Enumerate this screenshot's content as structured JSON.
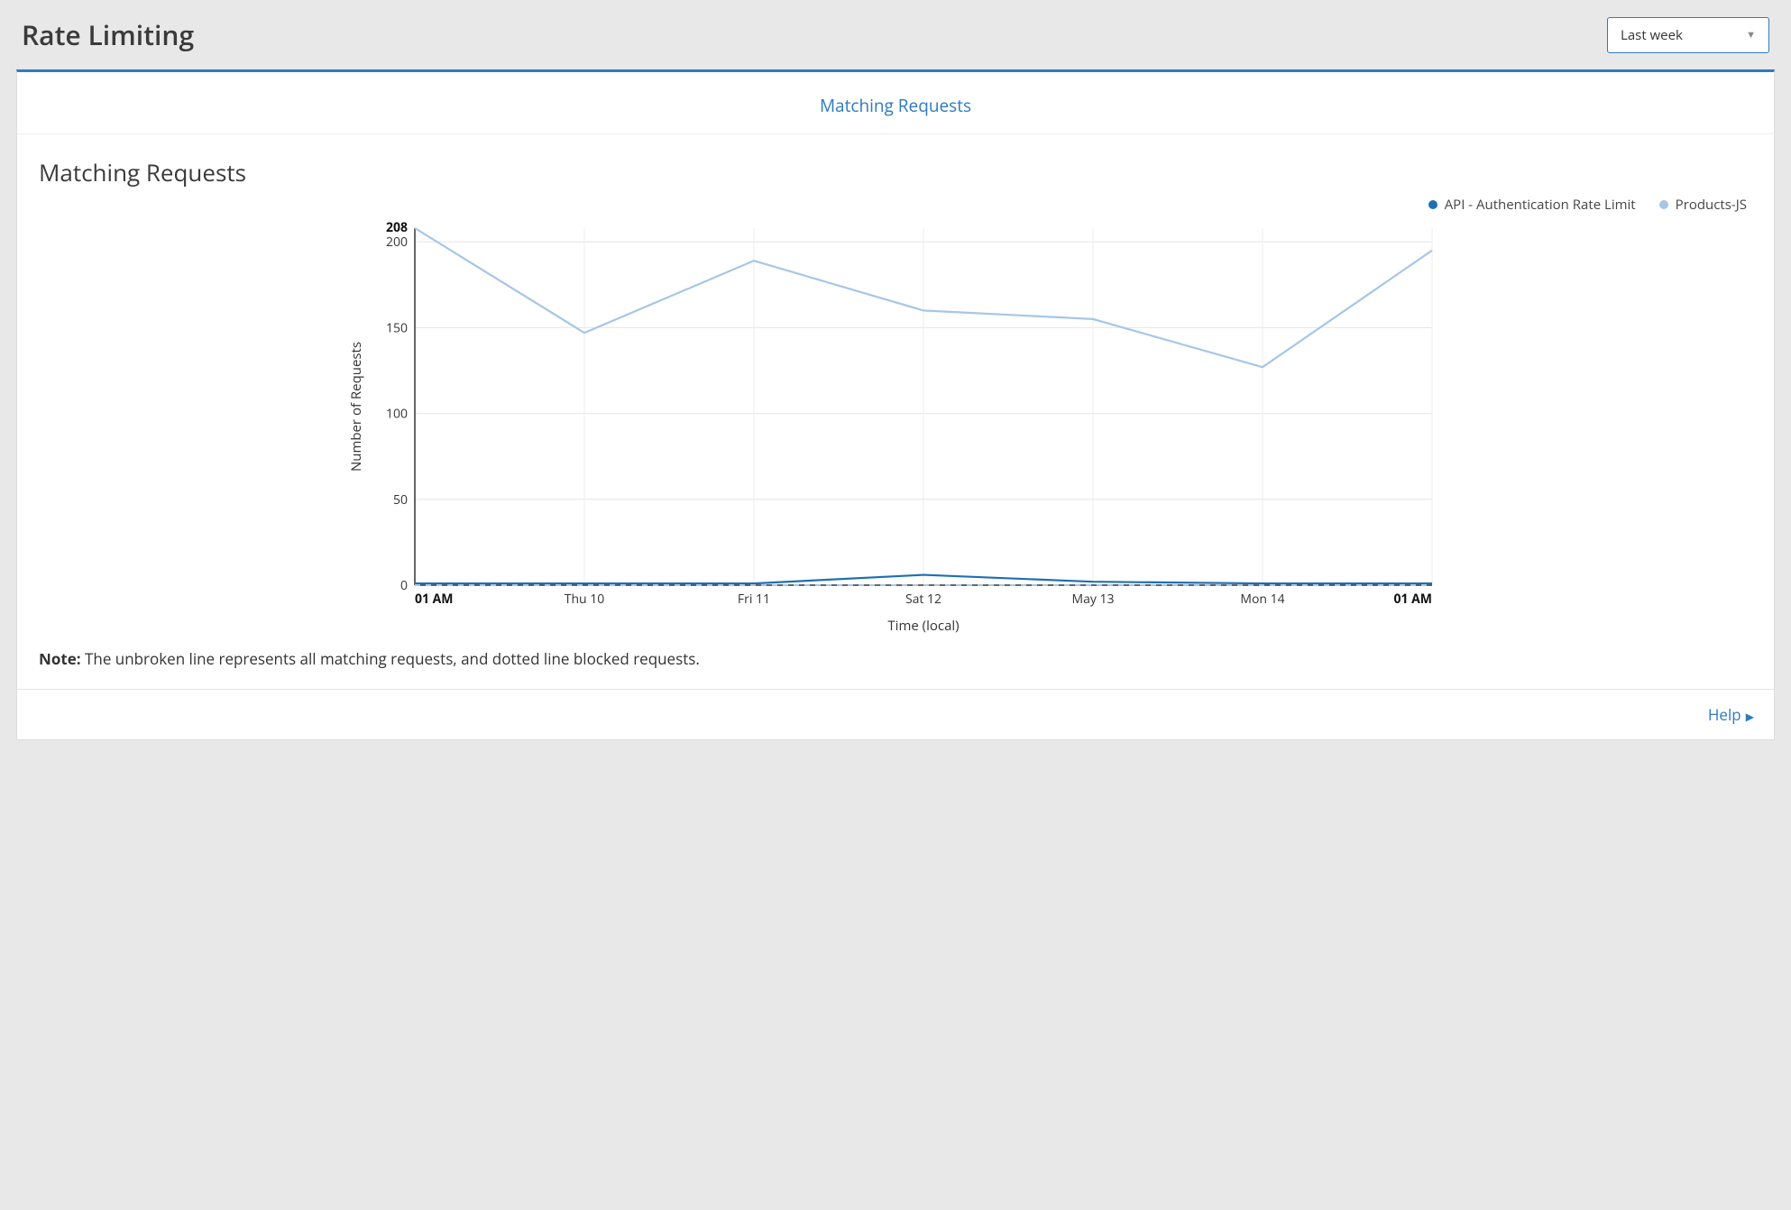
{
  "header": {
    "title": "Rate Limiting",
    "dropdown_value": "Last week"
  },
  "tabs": {
    "matching_requests": "Matching Requests"
  },
  "chart": {
    "title": "Matching Requests",
    "legend": [
      {
        "id": "api",
        "label": "API - Authentication Rate Limit",
        "color": "#1f6fb2"
      },
      {
        "id": "products",
        "label": "Products-JS",
        "color": "#a7c6e6"
      }
    ],
    "ylabel": "Number of Requests",
    "xlabel": "Time (local)",
    "ymax_label": "208"
  },
  "note": {
    "prefix": "Note:",
    "text": " The unbroken line represents all matching requests, and dotted line blocked requests."
  },
  "help": {
    "label": "Help"
  },
  "chart_data": {
    "type": "line",
    "xlabel": "Time (local)",
    "ylabel": "Number of Requests",
    "categories": [
      "01 AM",
      "Thu 10",
      "Fri 11",
      "Sat 12",
      "May 13",
      "Mon 14",
      "01 AM"
    ],
    "y_ticks": [
      0,
      50,
      100,
      150,
      200
    ],
    "ylim": [
      0,
      208
    ],
    "series": [
      {
        "name": "API - Authentication Rate Limit",
        "color": "#1f6fb2",
        "style": "solid",
        "values": [
          1,
          1,
          1,
          6,
          2,
          1,
          1
        ]
      },
      {
        "name": "API - Authentication Rate Limit (blocked)",
        "color": "#1f6fb2",
        "style": "dashed",
        "values": [
          0,
          0,
          0,
          0,
          0,
          0,
          0
        ]
      },
      {
        "name": "Products-JS",
        "color": "#a7c6e6",
        "style": "solid",
        "values": [
          208,
          147,
          189,
          160,
          155,
          127,
          195
        ]
      },
      {
        "name": "Products-JS (blocked)",
        "color": "#a7c6e6",
        "style": "dashed",
        "values": [
          0,
          0,
          0,
          0,
          0,
          0,
          0
        ]
      }
    ]
  }
}
